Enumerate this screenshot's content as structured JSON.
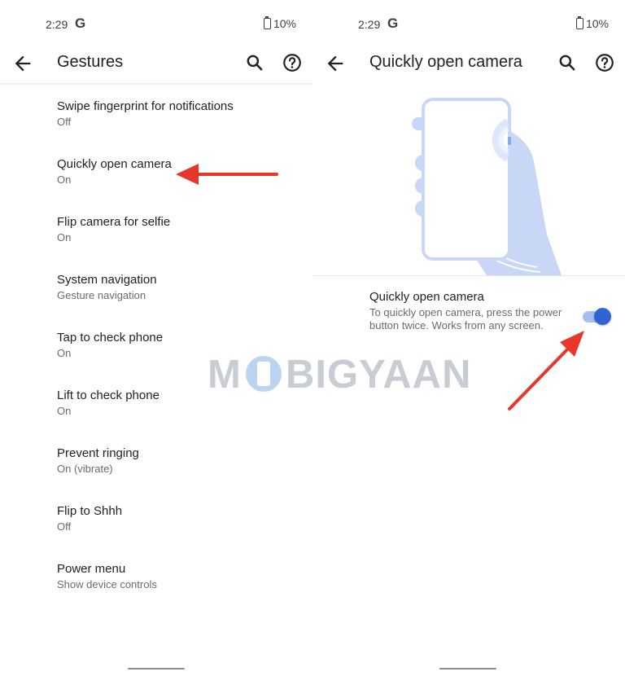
{
  "status": {
    "time": "2:29",
    "g_logo": "G",
    "battery": "10%"
  },
  "left": {
    "title": "Gestures",
    "items": [
      {
        "title": "Swipe fingerprint for notifications",
        "subtitle": "Off"
      },
      {
        "title": "Quickly open camera",
        "subtitle": "On"
      },
      {
        "title": "Flip camera for selfie",
        "subtitle": "On"
      },
      {
        "title": "System navigation",
        "subtitle": "Gesture navigation"
      },
      {
        "title": "Tap to check phone",
        "subtitle": "On"
      },
      {
        "title": "Lift to check phone",
        "subtitle": "On"
      },
      {
        "title": "Prevent ringing",
        "subtitle": "On (vibrate)"
      },
      {
        "title": "Flip to Shhh",
        "subtitle": "Off"
      },
      {
        "title": "Power menu",
        "subtitle": "Show device controls"
      }
    ]
  },
  "right": {
    "title": "Quickly open camera",
    "pref_title": "Quickly open camera",
    "pref_desc": "To quickly open camera, press the power button twice. Works from any screen.",
    "toggle_on": true
  },
  "watermark": {
    "pre": "M",
    "post": "BIGYAAN"
  },
  "colors": {
    "accent": "#2f63d6",
    "annotation_arrow": "#e8372a",
    "illustration_blue": "#c9d7f6"
  },
  "icons": [
    "back-arrow-icon",
    "search-icon",
    "help-icon",
    "battery-icon",
    "google-g-icon"
  ]
}
